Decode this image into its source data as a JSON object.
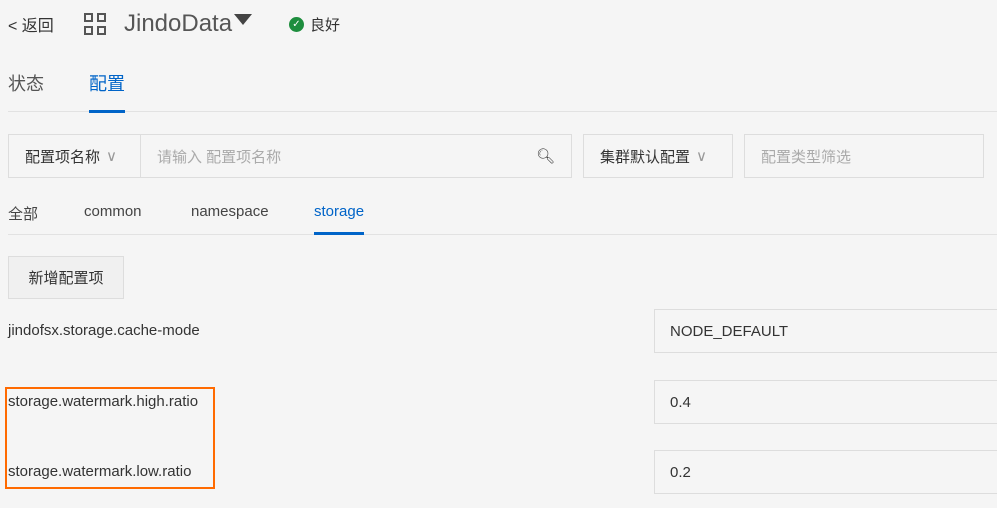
{
  "header": {
    "back": "返回",
    "title": "JindoData",
    "status": "良好"
  },
  "main_tabs": [
    "状态",
    "配置"
  ],
  "filters": {
    "field_select": "配置项名称",
    "search_placeholder": "请输入 配置项名称",
    "scope_select": "集群默认配置",
    "type_placeholder": "配置类型筛选"
  },
  "sub_tabs": [
    "全部",
    "common",
    "namespace",
    "storage"
  ],
  "add_button": "新增配置项",
  "configs": [
    {
      "key": "jindofsx.storage.cache-mode",
      "value": "NODE_DEFAULT"
    },
    {
      "key": "storage.watermark.high.ratio",
      "value": "0.4"
    },
    {
      "key": "storage.watermark.low.ratio",
      "value": "0.2"
    }
  ],
  "colors": {
    "accent": "#0064c8",
    "highlight": "#ff6a00",
    "status_ok": "#1e8e3e"
  }
}
